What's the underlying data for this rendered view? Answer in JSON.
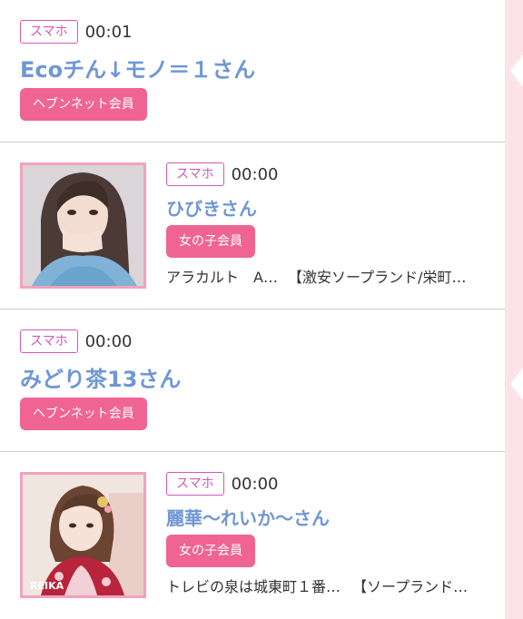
{
  "entries": [
    {
      "device_badge": "スマホ",
      "time": "00:01",
      "name": "Ecoチん↓モノ＝１さん",
      "member_label": "ヘブンネット会員"
    },
    {
      "device_badge": "スマホ",
      "time": "00:00",
      "name": "ひびきさん",
      "member_label": "女の子会員",
      "desc_left": "アラカルト　A…",
      "desc_right": "【激安ソープランド/栄町…",
      "photo": "woman-portrait-blue-dress"
    },
    {
      "device_badge": "スマホ",
      "time": "00:00",
      "name": "みどり茶13さん",
      "member_label": "ヘブンネット会員"
    },
    {
      "device_badge": "スマホ",
      "time": "00:00",
      "name": "麗華～れいか～さん",
      "member_label": "女の子会員",
      "desc_left": "トレビの泉は城東町１番…",
      "desc_right": "【ソープランド…",
      "photo": "woman-portrait-kimono",
      "photo_caption": "REIKA"
    }
  ],
  "colors": {
    "badge_border": "#d457b9",
    "name": "#6f97d6",
    "member_button": "#f06493",
    "photo_border": "#f3a2bd",
    "rail": "#fbe3e8"
  }
}
